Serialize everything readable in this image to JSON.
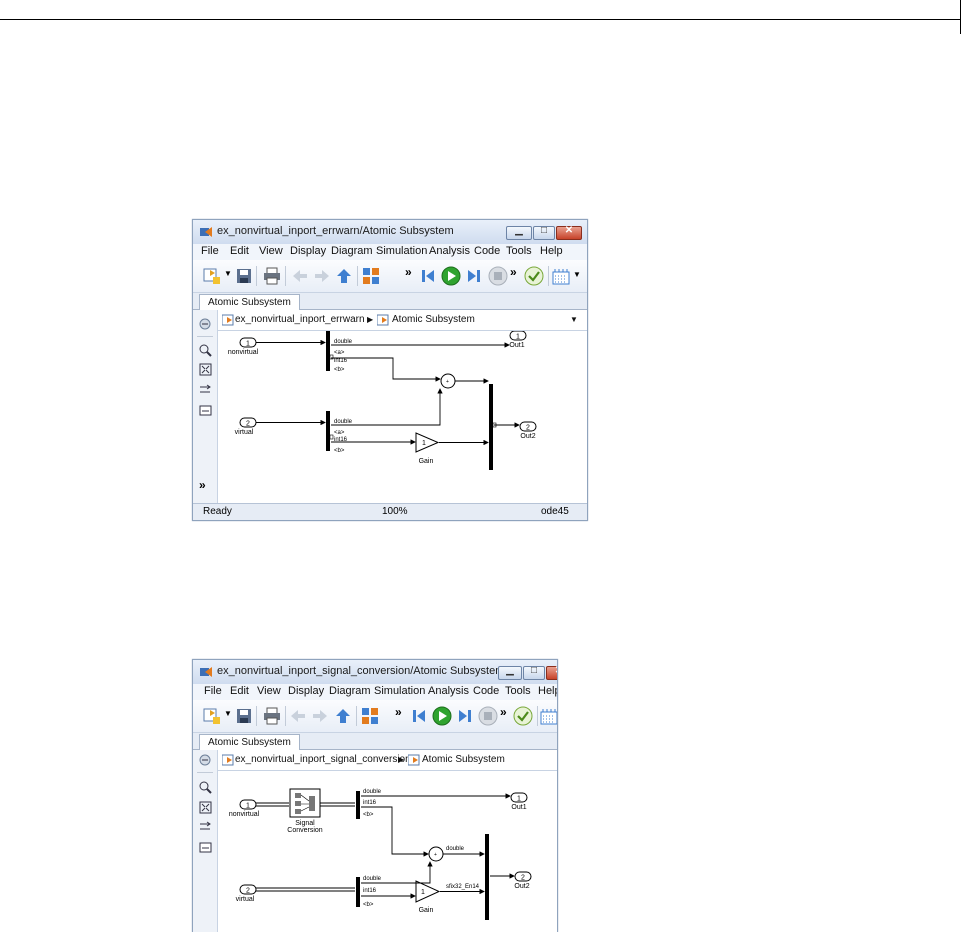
{
  "window1": {
    "title": "ex_nonvirtual_inport_errwarn/Atomic Subsystem",
    "menu": [
      "File",
      "Edit",
      "View",
      "Display",
      "Diagram",
      "Simulation",
      "Analysis",
      "Code",
      "Tools",
      "Help"
    ],
    "tab": "Atomic Subsystem",
    "breadcrumb": {
      "model": "ex_nonvirtual_inport_errwarn",
      "subsystem": "Atomic Subsystem"
    },
    "status": {
      "left": "Ready",
      "center": "100%",
      "right": "ode45"
    },
    "diagram": {
      "in1_num": "1",
      "in1_label": "nonvirtual",
      "in2_num": "2",
      "in2_label": "virtual",
      "out1_num": "1",
      "out1_label": "Out1",
      "out2_num": "2",
      "out2_label": "Out2",
      "gain_value": "1",
      "gain_label": "Gain",
      "sig_double": "double",
      "sig_a": "<a>",
      "sig_int16": "int16",
      "sig_b": "<b>"
    }
  },
  "window2": {
    "title": "ex_nonvirtual_inport_signal_conversion/Atomic Subsystem",
    "menu": [
      "File",
      "Edit",
      "View",
      "Display",
      "Diagram",
      "Simulation",
      "Analysis",
      "Code",
      "Tools",
      "Help"
    ],
    "tab": "Atomic Subsystem",
    "breadcrumb": {
      "model": "ex_nonvirtual_inport_signal_conversion",
      "subsystem": "Atomic Subsystem"
    },
    "diagram": {
      "in1_num": "1",
      "in1_label": "nonvirtual",
      "in2_num": "2",
      "in2_label": "virtual",
      "out1_num": "1",
      "out1_label": "Out1",
      "out2_num": "2",
      "out2_label": "Out2",
      "gain_value": "1",
      "gain_label": "Gain",
      "conv_label_1": "Signal",
      "conv_label_2": "Conversion",
      "sig_double": "double",
      "sig_int16": "int16",
      "sig_b": "<b>",
      "sum_out": "double",
      "gain_out": "sfix32_En14"
    }
  },
  "colors": {
    "titlebar": "#cfdcef",
    "close_button": "#c7432a",
    "run_green": "#2fa32f"
  }
}
